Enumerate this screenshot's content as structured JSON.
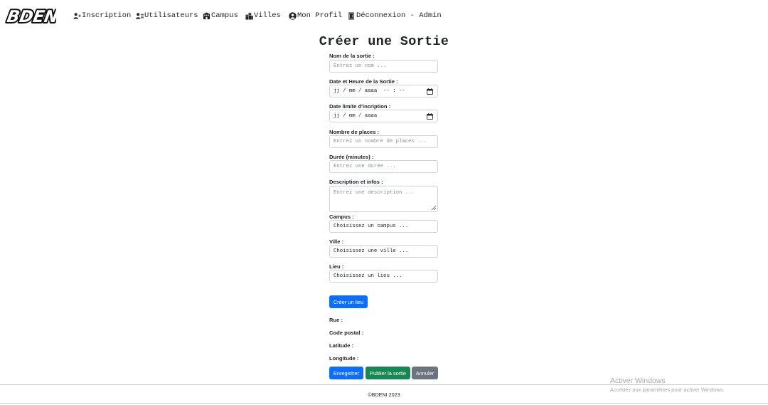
{
  "brand": {
    "logo_text": "BDENI"
  },
  "nav": {
    "inscription": "Inscription",
    "utilisateurs": "Utilisateurs",
    "campus": "Campus",
    "villes": "Villes",
    "profil": "Mon Profil",
    "deconnexion": "Déconnexion - Admin"
  },
  "page": {
    "title": "Créer une Sortie"
  },
  "form": {
    "nom": {
      "label": "Nom de la sortie :",
      "placeholder": "Entrez un nom ..."
    },
    "date_heure": {
      "label": "Date et Heure de la Sortie :",
      "value": "jj / mm / aaaa  -- : --"
    },
    "date_limite": {
      "label": "Date limite d'incription :",
      "value": "jj / mm / aaaa"
    },
    "places": {
      "label": "Nombre de places :",
      "placeholder": "Entrez un nombre de places ..."
    },
    "duree": {
      "label": "Durée (minutes) :",
      "placeholder": "Entrez une durée ..."
    },
    "description": {
      "label": "Description et infos :",
      "placeholder": "Entrez une description ..."
    },
    "campus": {
      "label": "Campus :",
      "value": "Choisissez un campus ..."
    },
    "ville": {
      "label": "Ville :",
      "value": "Choisissez une ville ..."
    },
    "lieu": {
      "label": "Lieu :",
      "value": "Choisissez un lieu ..."
    },
    "creer_lieu": "Créer un lieu",
    "rue_label": "Rue :",
    "code_postal_label": "Code postal :",
    "latitude_label": "Latitude :",
    "longitude_label": "Longitude :"
  },
  "actions": {
    "enregistrer": "Enregistrer",
    "publier": "Publier la sortie",
    "annuler": "Annuler"
  },
  "footer": {
    "text": "©BDENI 2023"
  },
  "watermark": {
    "title": "Activer Windows",
    "subtitle": "Accédez aux paramètres pour activer Windows."
  },
  "colors": {
    "primary": "#0d6efd",
    "success": "#198754",
    "secondary": "#6c757d"
  },
  "icons": {
    "inscription": "user-plus-icon",
    "utilisateurs": "user-list-icon",
    "campus": "building-icon",
    "villes": "city-icon",
    "profil": "user-circle-icon",
    "deconnexion": "door-icon",
    "calendar": "calendar-icon"
  }
}
